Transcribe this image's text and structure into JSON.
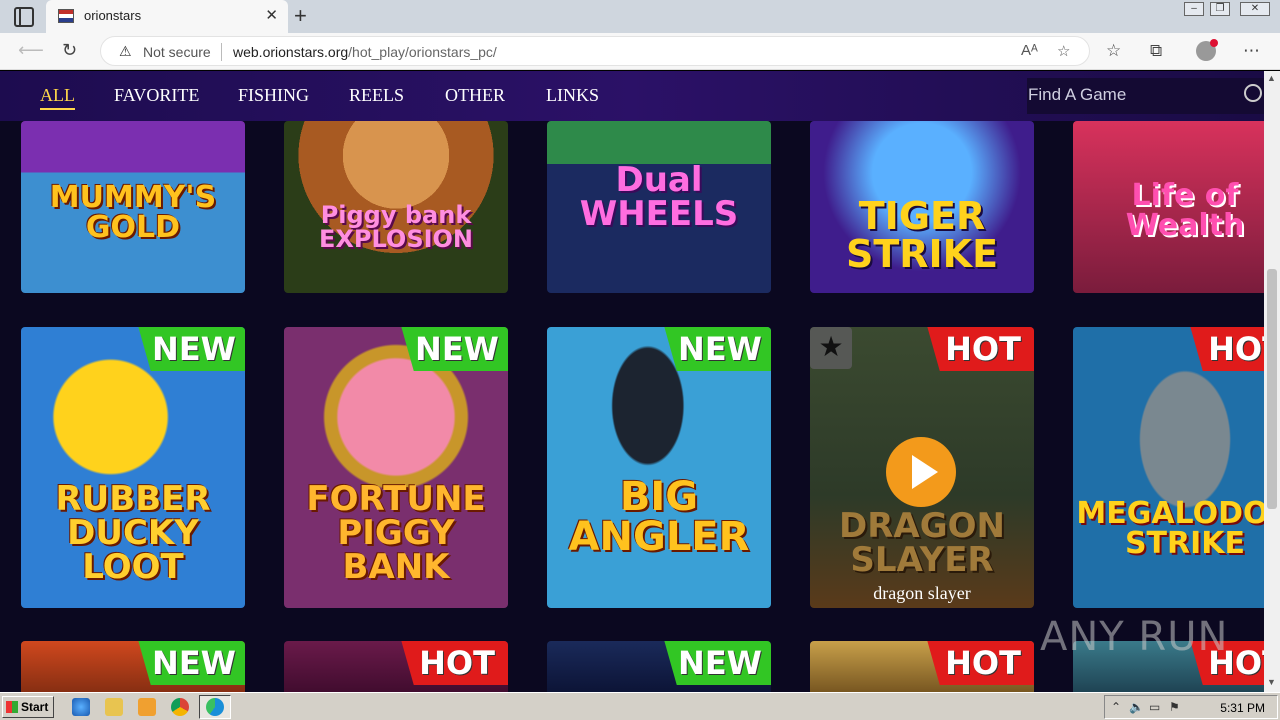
{
  "browser": {
    "tab_title": "orionstars",
    "new_tab": "+",
    "close_tab": "✕",
    "security_label": "Not secure",
    "url_domain": "web.orionstars.org",
    "url_path": "/hot_play/orionstars_pc/",
    "window_controls": [
      "–",
      "❐",
      "✕"
    ]
  },
  "site": {
    "nav_items": [
      "ALL",
      "FAVORITE",
      "FISHING",
      "REELS",
      "OTHER",
      "LINKS"
    ],
    "active_nav": "ALL",
    "search_placeholder": "Find A Game"
  },
  "games_row1": [
    {
      "title": "MUMMY'S GOLD",
      "bg": "#3d8fd0"
    },
    {
      "title": "Piggy bank EXPLOSION",
      "bg": "#2b3d18"
    },
    {
      "title": "Dual WHEELS",
      "bg": "#1b2a60"
    },
    {
      "title": "TIGER STRIKE",
      "bg": "#3f1d8c"
    },
    {
      "title": "Life of Wealth",
      "bg": "#7a1c3c"
    }
  ],
  "games_row2": [
    {
      "title": "RUBBER DUCKY LOOT",
      "badge": "NEW",
      "bg": "#2f7fd4"
    },
    {
      "title": "FORTUNE PIGGY BANK",
      "badge": "NEW",
      "bg": "#7a2f6e"
    },
    {
      "title": "BIG ANGLER",
      "badge": "NEW",
      "bg": "#3aa0d6"
    },
    {
      "title": "DRAGON SLAYER",
      "badge": "HOT",
      "caption": "dragon slayer",
      "bg": "#2d3a28"
    },
    {
      "title": "MEGALODON STRIKE",
      "badge": "HOT",
      "bg": "#1f6fa8"
    }
  ],
  "games_row3_badges": [
    "NEW",
    "HOT",
    "NEW",
    "HOT",
    "HOT"
  ],
  "taskbar": {
    "start_label": "Start",
    "clock": "5:31 PM"
  },
  "watermark": "ANY RUN"
}
